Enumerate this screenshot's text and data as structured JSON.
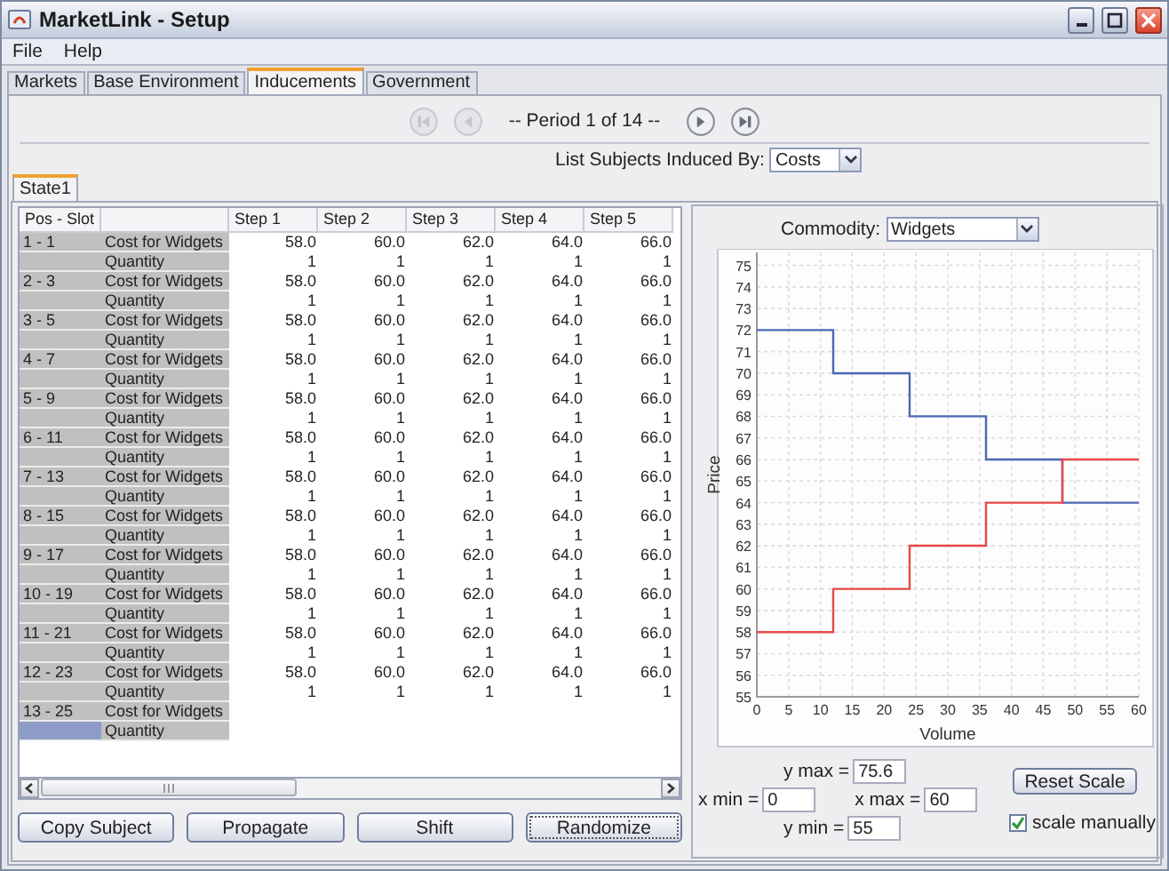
{
  "window": {
    "title": "MarketLink - Setup"
  },
  "menu": [
    "File",
    "Help"
  ],
  "tabs": [
    {
      "label": "Markets",
      "selected": false
    },
    {
      "label": "Base Environment",
      "selected": false
    },
    {
      "label": "Inducements",
      "selected": true
    },
    {
      "label": "Government",
      "selected": false
    }
  ],
  "navigation": {
    "period": "-- Period 1 of 14 --",
    "buttons": [
      {
        "kind": "first",
        "disabled": true
      },
      {
        "kind": "previous",
        "disabled": true
      },
      {
        "kind": "next",
        "disabled": false
      },
      {
        "kind": "last",
        "disabled": false
      }
    ]
  },
  "filter": {
    "label": "List Subjects Induced By:",
    "value": "Costs"
  },
  "state_tabs": [
    {
      "label": "State1",
      "selected": true
    }
  ],
  "table": {
    "columns": {
      "pos_slot": "Pos - Slot",
      "steps": [
        "Step 1",
        "Step 2",
        "Step 3",
        "Step 4",
        "Step 5"
      ]
    },
    "rows": [
      {
        "pos_slot": "1 - 1",
        "label": "Cost for Widgets",
        "values": [
          "58.0",
          "60.0",
          "62.0",
          "64.0",
          "66.0"
        ],
        "selected": false
      },
      {
        "label": "Quantity",
        "values": [
          "1",
          "1",
          "1",
          "1",
          "1"
        ],
        "selected": false
      },
      {
        "pos_slot": "2 - 3",
        "label": "Cost for Widgets",
        "values": [
          "58.0",
          "60.0",
          "62.0",
          "64.0",
          "66.0"
        ],
        "selected": false
      },
      {
        "label": "Quantity",
        "values": [
          "1",
          "1",
          "1",
          "1",
          "1"
        ],
        "selected": false
      },
      {
        "pos_slot": "3 - 5",
        "label": "Cost for Widgets",
        "values": [
          "58.0",
          "60.0",
          "62.0",
          "64.0",
          "66.0"
        ],
        "selected": false
      },
      {
        "label": "Quantity",
        "values": [
          "1",
          "1",
          "1",
          "1",
          "1"
        ],
        "selected": false
      },
      {
        "pos_slot": "4 - 7",
        "label": "Cost for Widgets",
        "values": [
          "58.0",
          "60.0",
          "62.0",
          "64.0",
          "66.0"
        ],
        "selected": false
      },
      {
        "label": "Quantity",
        "values": [
          "1",
          "1",
          "1",
          "1",
          "1"
        ],
        "selected": false
      },
      {
        "pos_slot": "5 - 9",
        "label": "Cost for Widgets",
        "values": [
          "58.0",
          "60.0",
          "62.0",
          "64.0",
          "66.0"
        ],
        "selected": false
      },
      {
        "label": "Quantity",
        "values": [
          "1",
          "1",
          "1",
          "1",
          "1"
        ],
        "selected": false
      },
      {
        "pos_slot": "6 - 11",
        "label": "Cost for Widgets",
        "values": [
          "58.0",
          "60.0",
          "62.0",
          "64.0",
          "66.0"
        ],
        "selected": false
      },
      {
        "label": "Quantity",
        "values": [
          "1",
          "1",
          "1",
          "1",
          "1"
        ],
        "selected": false
      },
      {
        "pos_slot": "7 - 13",
        "label": "Cost for Widgets",
        "values": [
          "58.0",
          "60.0",
          "62.0",
          "64.0",
          "66.0"
        ],
        "selected": false
      },
      {
        "label": "Quantity",
        "values": [
          "1",
          "1",
          "1",
          "1",
          "1"
        ],
        "selected": false
      },
      {
        "pos_slot": "8 - 15",
        "label": "Cost for Widgets",
        "values": [
          "58.0",
          "60.0",
          "62.0",
          "64.0",
          "66.0"
        ],
        "selected": false
      },
      {
        "label": "Quantity",
        "values": [
          "1",
          "1",
          "1",
          "1",
          "1"
        ],
        "selected": false
      },
      {
        "pos_slot": "9 - 17",
        "label": "Cost for Widgets",
        "values": [
          "58.0",
          "60.0",
          "62.0",
          "64.0",
          "66.0"
        ],
        "selected": false
      },
      {
        "label": "Quantity",
        "values": [
          "1",
          "1",
          "1",
          "1",
          "1"
        ],
        "selected": false
      },
      {
        "pos_slot": "10 - 19",
        "label": "Cost for Widgets",
        "values": [
          "58.0",
          "60.0",
          "62.0",
          "64.0",
          "66.0"
        ],
        "selected": false
      },
      {
        "label": "Quantity",
        "values": [
          "1",
          "1",
          "1",
          "1",
          "1"
        ],
        "selected": false
      },
      {
        "pos_slot": "11 - 21",
        "label": "Cost for Widgets",
        "values": [
          "58.0",
          "60.0",
          "62.0",
          "64.0",
          "66.0"
        ],
        "selected": false
      },
      {
        "label": "Quantity",
        "values": [
          "1",
          "1",
          "1",
          "1",
          "1"
        ],
        "selected": false
      },
      {
        "pos_slot": "12 - 23",
        "label": "Cost for Widgets",
        "values": [
          "58.0",
          "60.0",
          "62.0",
          "64.0",
          "66.0"
        ],
        "selected": false
      },
      {
        "label": "Quantity",
        "values": [
          "1",
          "1",
          "1",
          "1",
          "1"
        ],
        "selected": false
      },
      {
        "pos_slot": "13 - 25",
        "label": "Cost for Widgets",
        "selected": false
      },
      {
        "label": "Quantity",
        "selected": true
      }
    ]
  },
  "actions": [
    {
      "label": "Copy Subject",
      "focused": false
    },
    {
      "label": "Propagate",
      "focused": false
    },
    {
      "label": "Shift",
      "focused": false
    },
    {
      "label": "Randomize",
      "focused": true
    }
  ],
  "chart_panel": {
    "commodity": {
      "label": "Commodity:",
      "value": "Widgets"
    },
    "chart_data": {
      "type": "line",
      "grid": true,
      "xlabel": "Volume",
      "ylabel": "Price",
      "x": [
        0,
        12,
        12,
        24,
        24,
        36,
        36,
        48,
        48,
        60
      ],
      "series": [
        {
          "color": "#4a68b4",
          "values": [
            72,
            72,
            70,
            70,
            68,
            68,
            66,
            66,
            64,
            64
          ]
        },
        {
          "color": "#e84848",
          "values": [
            58,
            58,
            60,
            60,
            62,
            62,
            64,
            64,
            66,
            66
          ]
        }
      ],
      "xlim": [
        0,
        60
      ],
      "ylim": [
        55,
        75.6
      ],
      "xticks": [
        0,
        5,
        10,
        15,
        20,
        25,
        30,
        35,
        40,
        45,
        50,
        55,
        60
      ],
      "yticks": [
        55,
        56,
        57,
        58,
        59,
        60,
        61,
        62,
        63,
        64,
        65,
        66,
        67,
        68,
        69,
        70,
        71,
        72,
        73,
        74,
        75
      ]
    },
    "fields": [
      {
        "kind": "y_max",
        "label": "y max =",
        "value": "75.6"
      },
      {
        "kind": "x_min",
        "label": "x min =",
        "value": "0"
      },
      {
        "kind": "x_max",
        "label": "x max =",
        "value": "60"
      },
      {
        "kind": "y_min",
        "label": "y min =",
        "value": "55"
      }
    ],
    "reset_button": "Reset Scale",
    "scale_manually": {
      "label": "scale manually",
      "checked": true
    }
  }
}
